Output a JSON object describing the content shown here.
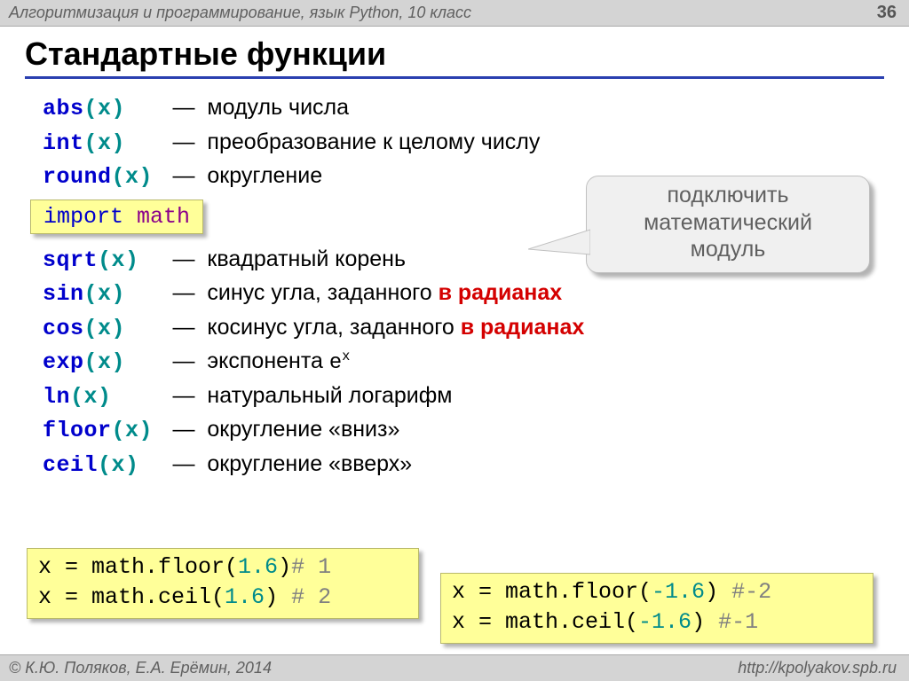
{
  "header": {
    "text": "Алгоритмизация и программирование, язык Python, 10 класс",
    "page": "36"
  },
  "title": "Стандартные функции",
  "funcs1": [
    {
      "name": "abs",
      "arg": "(x)",
      "pad": "   ",
      "dash": "—",
      "space": "  ",
      "desc": "модуль числа"
    },
    {
      "name": "int",
      "arg": "(x)",
      "pad": "   ",
      "dash": "—",
      "space": "  ",
      "desc": "преобразование к целому числу"
    },
    {
      "name": "round",
      "arg": "(x)",
      "pad": " ",
      "dash": "—",
      "space": "  ",
      "desc": "округление"
    }
  ],
  "import_stmt": {
    "kw": "import ",
    "mod": "math"
  },
  "callout": {
    "l1": "подключить",
    "l2": "математический",
    "l3": "модуль"
  },
  "funcs2": [
    {
      "name": "sqrt",
      "arg": "(x)",
      "pad": "  ",
      "dash": "—",
      "space": "  ",
      "desc": "квадратный корень",
      "red": ""
    },
    {
      "name": "sin",
      "arg": "(x)",
      "pad": "   ",
      "dash": "—",
      "space": "  ",
      "desc": "синус угла, заданного ",
      "red": "в радианах"
    },
    {
      "name": "cos",
      "arg": "(x)",
      "pad": "   ",
      "dash": "—",
      "space": "  ",
      "desc": "косинус угла, заданного ",
      "red": "в радианах"
    },
    {
      "name": "exp",
      "arg": "(x)",
      "pad": "   ",
      "dash": "—",
      "space": "  ",
      "desc": "экспонента ",
      "exp": true
    },
    {
      "name": "ln",
      "arg": "(x)",
      "pad": "    ",
      "dash": "—",
      "space": "  ",
      "desc": "натуральный логарифм",
      "red": ""
    },
    {
      "name": "floor",
      "arg": "(x)",
      "pad": " ",
      "dash": "—",
      "space": "  ",
      "desc": "округление «вниз»",
      "red": ""
    },
    {
      "name": "ceil",
      "arg": "(x)",
      "pad": "  ",
      "dash": "—",
      "space": "  ",
      "desc": "округление «вверх»",
      "red": ""
    }
  ],
  "exp_symbol": "e",
  "exp_sup": "x",
  "box_left": {
    "l1_pre": "x = math.floor(",
    "l1_num": "1.6",
    "l1_post": ")",
    "l1_cmt": "# 1",
    "l2_pre": "x = math.ceil(",
    "l2_num": "1.6",
    "l2_post": ") ",
    "l2_cmt": "# 2"
  },
  "box_right": {
    "l1_pre": "x = math.floor(",
    "l1_num": "-1.6",
    "l1_post": ") ",
    "l1_cmt": "#-2",
    "l2_pre": "x = math.ceil(",
    "l2_num": "-1.6",
    "l2_post": ")  ",
    "l2_cmt": "#-1"
  },
  "footer": {
    "left": "© К.Ю. Поляков, Е.А. Ерёмин, 2014",
    "right": "http://kpolyakov.spb.ru"
  }
}
